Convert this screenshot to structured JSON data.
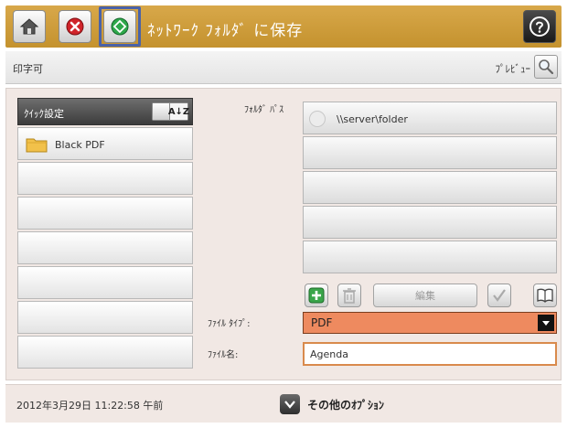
{
  "header": {
    "title": "ﾈｯﾄﾜｰｸ ﾌｫﾙﾀﾞ に保存"
  },
  "subbar": {
    "left_text": "印字可",
    "preview_label": "ﾌﾟﾚﾋﾞｭｰ"
  },
  "quick_sets": {
    "header_label": "ｸｲｯｸ設定",
    "sort_label": "A↓Z",
    "items": [
      {
        "label": "Black PDF"
      },
      {
        "label": ""
      },
      {
        "label": ""
      },
      {
        "label": ""
      },
      {
        "label": ""
      },
      {
        "label": ""
      },
      {
        "label": ""
      }
    ]
  },
  "folder_paths": {
    "label": "ﾌｫﾙﾀﾞ ﾊﾟｽ",
    "rows": [
      {
        "text": "\\\\server\\folder"
      },
      {
        "text": ""
      },
      {
        "text": ""
      },
      {
        "text": ""
      },
      {
        "text": ""
      }
    ]
  },
  "toolbar": {
    "edit_label": "編集"
  },
  "file_type": {
    "label": "ﾌｧｲﾙ ﾀｲﾌﾟ:",
    "value": "PDF"
  },
  "file_name": {
    "label": "ﾌｧｲﾙ名:",
    "value": "Agenda"
  },
  "footer": {
    "timestamp": "2012年3月29日 11:22:58 午前",
    "more_options_label": "その他のｵﾌﾟｼｮﾝ"
  },
  "colors": {
    "title_bar": "#c99a3a",
    "panel_bg": "#f1e8e4",
    "file_type_highlight": "#ee8a5f",
    "file_name_border": "#d98a4c",
    "start_frame": "#4a62a8"
  }
}
